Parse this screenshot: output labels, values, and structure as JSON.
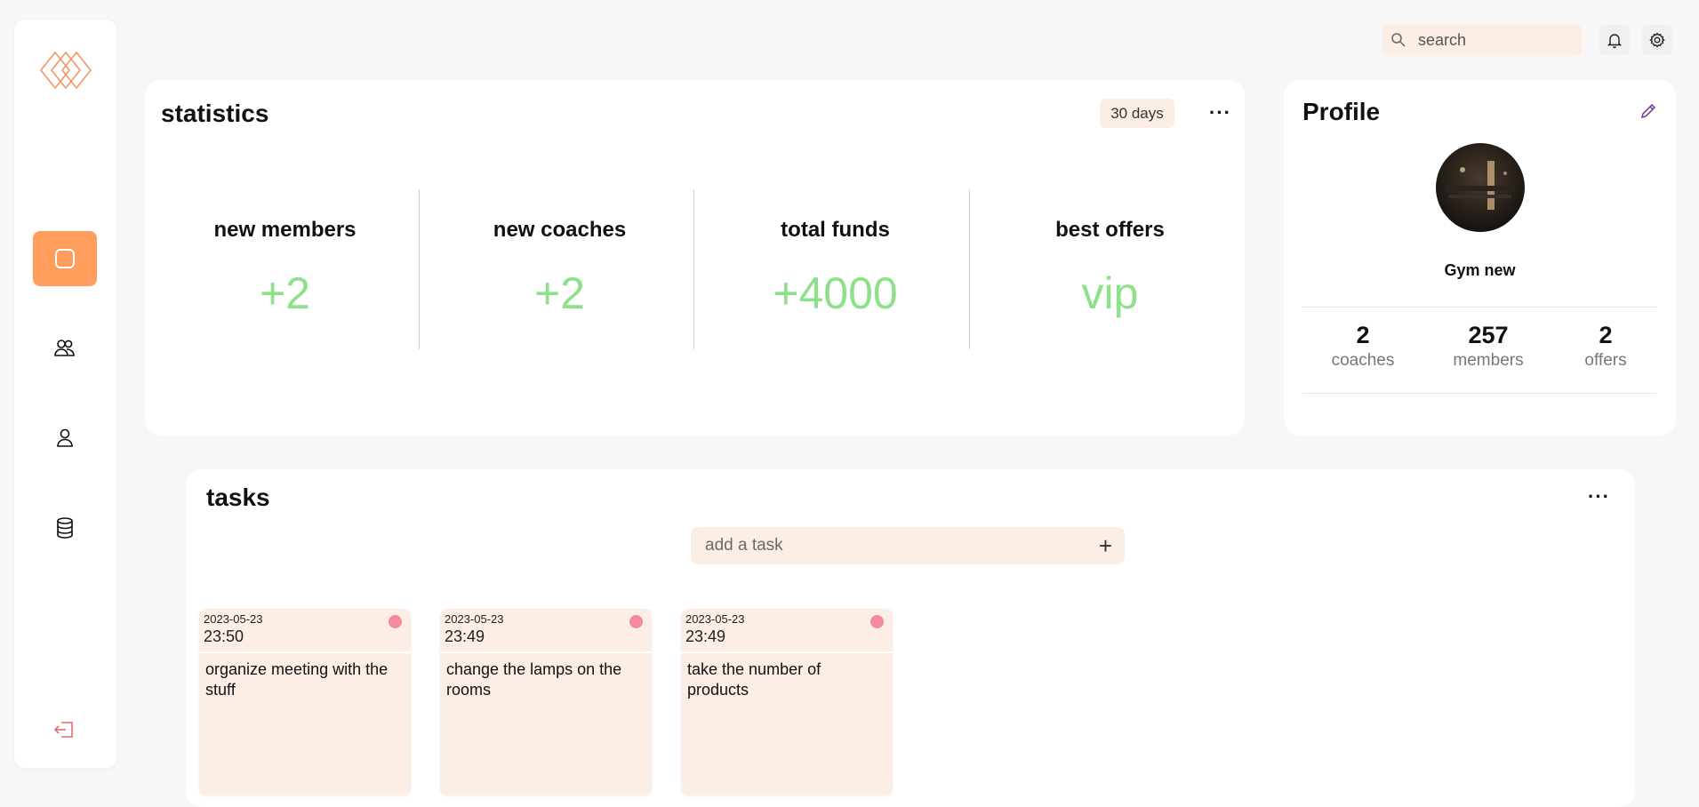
{
  "sidebar": {
    "logo": "logo-icon",
    "items": [
      {
        "name": "dashboard",
        "icon": "square-icon",
        "active": true
      },
      {
        "name": "members",
        "icon": "users-icon"
      },
      {
        "name": "profile",
        "icon": "user-icon"
      },
      {
        "name": "database",
        "icon": "database-icon"
      }
    ],
    "logout_icon": "logout-icon"
  },
  "topbar": {
    "search_placeholder": "search",
    "notification_icon": "bell-icon",
    "settings_icon": "gear-icon"
  },
  "statistics": {
    "title": "statistics",
    "period": "30 days",
    "menu": "···",
    "items": [
      {
        "label": "new members",
        "value": "+2"
      },
      {
        "label": "new coaches",
        "value": "+2"
      },
      {
        "label": "total funds",
        "value": "+4000"
      },
      {
        "label": "best offers",
        "value": "vip"
      }
    ]
  },
  "profile": {
    "title": "Profile",
    "name": "Gym new",
    "stats": [
      {
        "value": "2",
        "label": "coaches"
      },
      {
        "value": "257",
        "label": "members"
      },
      {
        "value": "2",
        "label": "offers"
      }
    ]
  },
  "tasks": {
    "title": "tasks",
    "menu": "···",
    "input_placeholder": "add a task",
    "add_label": "+",
    "items": [
      {
        "date": "2023-05-23",
        "time": "23:50",
        "text": "organize meeting with the stuff"
      },
      {
        "date": "2023-05-23",
        "time": "23:49",
        "text": "change the lamps on the rooms"
      },
      {
        "date": "2023-05-23",
        "time": "23:49",
        "text": "take the number of products"
      }
    ]
  },
  "colors": {
    "accent": "#ff9d5c",
    "stat_value": "#8ee08a",
    "soft_peach": "#fdeee5",
    "task_dot": "#f48aa0"
  }
}
